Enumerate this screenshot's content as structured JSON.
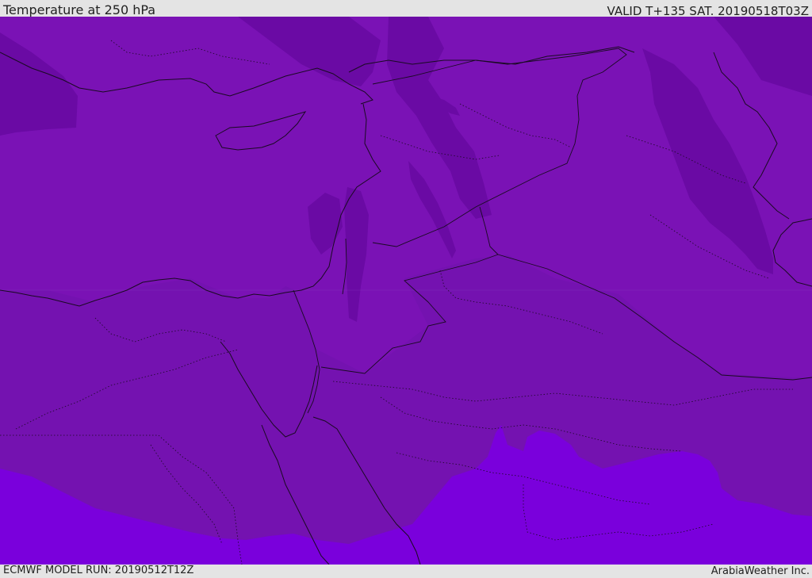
{
  "header": {
    "title": "Temperature at 250 hPa",
    "valid_time": "VALID T+135 SAT. 20190518T03Z"
  },
  "footer": {
    "model_run": "ECMWF MODEL RUN: 20190512T12Z",
    "credit": "ArabiaWeather Inc."
  },
  "map": {
    "variable": "temperature",
    "pressure_level_hpa": 250,
    "colors": {
      "base": "#7a12b5",
      "cold": "#6a0aa4",
      "mid": "#7412b0",
      "warm": "#7a00dc",
      "borders": "#1a0a22"
    }
  }
}
